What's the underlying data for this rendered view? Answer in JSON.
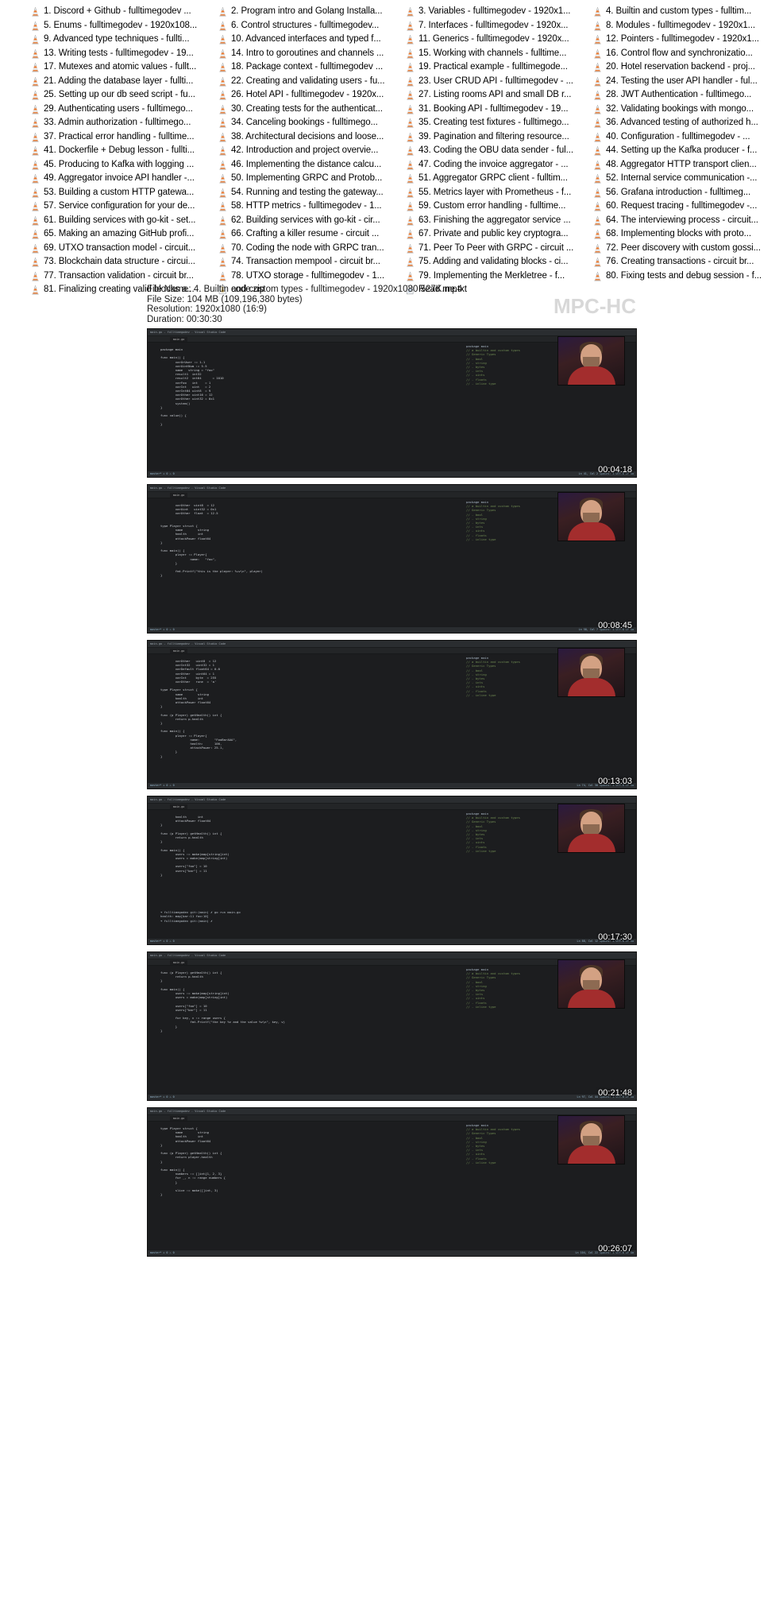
{
  "window": {
    "app_name": "MPC-HC"
  },
  "filelist": {
    "icon_name": "vlc-cone-icon",
    "zip_icon_name": "zip-archive-icon",
    "text_icon_name": "text-file-icon",
    "items": [
      {
        "label": "1. Discord + Github - fulltimegodev ...",
        "icon": "vlc-cone-icon"
      },
      {
        "label": "2. Program intro and Golang Installa...",
        "icon": "vlc-cone-icon"
      },
      {
        "label": "3. Variables - fulltimegodev - 1920x1...",
        "icon": "vlc-cone-icon"
      },
      {
        "label": "4. Builtin and custom types - fulltim...",
        "icon": "vlc-cone-icon"
      },
      {
        "label": "5. Enums - fulltimegodev - 1920x108...",
        "icon": "vlc-cone-icon"
      },
      {
        "label": "6. Control structures - fulltimegodev...",
        "icon": "vlc-cone-icon"
      },
      {
        "label": "7. Interfaces - fulltimegodev - 1920x...",
        "icon": "vlc-cone-icon"
      },
      {
        "label": "8. Modules - fulltimegodev - 1920x1...",
        "icon": "vlc-cone-icon"
      },
      {
        "label": "9. Advanced type techniques - fullti...",
        "icon": "vlc-cone-icon"
      },
      {
        "label": "10. Advanced interfaces and typed f...",
        "icon": "vlc-cone-icon"
      },
      {
        "label": "11. Generics - fulltimegodev - 1920x...",
        "icon": "vlc-cone-icon"
      },
      {
        "label": "12. Pointers - fulltimegodev - 1920x1...",
        "icon": "vlc-cone-icon"
      },
      {
        "label": "13. Writing tests - fulltimegodev - 19...",
        "icon": "vlc-cone-icon"
      },
      {
        "label": "14. Intro to goroutines and channels ...",
        "icon": "vlc-cone-icon"
      },
      {
        "label": "15. Working with channels - fulltime...",
        "icon": "vlc-cone-icon"
      },
      {
        "label": "16. Control flow and synchronizatio...",
        "icon": "vlc-cone-icon"
      },
      {
        "label": "17. Mutexes and atomic values - fullt...",
        "icon": "vlc-cone-icon"
      },
      {
        "label": "18. Package context - fulltimegodev ...",
        "icon": "vlc-cone-icon"
      },
      {
        "label": "19. Practical example - fulltimegode...",
        "icon": "vlc-cone-icon"
      },
      {
        "label": "20. Hotel reservation backend - proj...",
        "icon": "vlc-cone-icon"
      },
      {
        "label": "21. Adding the database layer - fullti...",
        "icon": "vlc-cone-icon"
      },
      {
        "label": "22. Creating and validating users - fu...",
        "icon": "vlc-cone-icon"
      },
      {
        "label": "23. User CRUD API - fulltimegodev - ...",
        "icon": "vlc-cone-icon"
      },
      {
        "label": "24. Testing the user API handler - ful...",
        "icon": "vlc-cone-icon"
      },
      {
        "label": "25. Setting up our db seed script - fu...",
        "icon": "vlc-cone-icon"
      },
      {
        "label": "26. Hotel API - fulltimegodev - 1920x...",
        "icon": "vlc-cone-icon"
      },
      {
        "label": "27. Listing rooms API and small DB r...",
        "icon": "vlc-cone-icon"
      },
      {
        "label": "28. JWT Authentication - fulltimego...",
        "icon": "vlc-cone-icon"
      },
      {
        "label": "29. Authenticating users - fulltimego...",
        "icon": "vlc-cone-icon"
      },
      {
        "label": "30. Creating tests for the authenticat...",
        "icon": "vlc-cone-icon"
      },
      {
        "label": "31. Booking API - fulltimegodev - 19...",
        "icon": "vlc-cone-icon"
      },
      {
        "label": "32. Validating bookings with mongo...",
        "icon": "vlc-cone-icon"
      },
      {
        "label": "33. Admin authorization - fulltimego...",
        "icon": "vlc-cone-icon"
      },
      {
        "label": "34. Canceling bookings - fulltimego...",
        "icon": "vlc-cone-icon"
      },
      {
        "label": "35. Creating test fixtures - fulltimego...",
        "icon": "vlc-cone-icon"
      },
      {
        "label": "36. Advanced testing of authorized h...",
        "icon": "vlc-cone-icon"
      },
      {
        "label": "37. Practical error handling - fulltime...",
        "icon": "vlc-cone-icon"
      },
      {
        "label": "38. Architectural decisions and loose...",
        "icon": "vlc-cone-icon"
      },
      {
        "label": "39. Pagination and filtering resource...",
        "icon": "vlc-cone-icon"
      },
      {
        "label": "40. Configuration - fulltimegodev - ...",
        "icon": "vlc-cone-icon"
      },
      {
        "label": "41. Dockerfile + Debug lesson - fullti...",
        "icon": "vlc-cone-icon"
      },
      {
        "label": "42. Introduction and project overvie...",
        "icon": "vlc-cone-icon"
      },
      {
        "label": "43. Coding the OBU data sender - ful...",
        "icon": "vlc-cone-icon"
      },
      {
        "label": "44. Setting up the Kafka producer - f...",
        "icon": "vlc-cone-icon"
      },
      {
        "label": "45. Producing to Kafka with logging ...",
        "icon": "vlc-cone-icon"
      },
      {
        "label": "46. Implementing the distance calcu...",
        "icon": "vlc-cone-icon"
      },
      {
        "label": "47. Coding the invoice aggregator - ...",
        "icon": "vlc-cone-icon"
      },
      {
        "label": "48. Aggregator HTTP transport clien...",
        "icon": "vlc-cone-icon"
      },
      {
        "label": "49. Aggregator invoice API handler -...",
        "icon": "vlc-cone-icon"
      },
      {
        "label": "50. Implementing GRPC and Protob...",
        "icon": "vlc-cone-icon"
      },
      {
        "label": "51. Aggregator GRPC client - fulltim...",
        "icon": "vlc-cone-icon"
      },
      {
        "label": "52. Internal service communication -...",
        "icon": "vlc-cone-icon"
      },
      {
        "label": "53. Building a custom HTTP gatewa...",
        "icon": "vlc-cone-icon"
      },
      {
        "label": "54. Running and testing the gateway...",
        "icon": "vlc-cone-icon"
      },
      {
        "label": "55. Metrics layer with Prometheus - f...",
        "icon": "vlc-cone-icon"
      },
      {
        "label": "56. Grafana introduction - fulltimeg...",
        "icon": "vlc-cone-icon"
      },
      {
        "label": "57. Service configuration for your de...",
        "icon": "vlc-cone-icon"
      },
      {
        "label": "58. HTTP metrics - fulltimegodev - 1...",
        "icon": "vlc-cone-icon"
      },
      {
        "label": "59. Custom error handling - fulltime...",
        "icon": "vlc-cone-icon"
      },
      {
        "label": "60. Request tracing - fulltimegodev -...",
        "icon": "vlc-cone-icon"
      },
      {
        "label": "61. Building services with go-kit - set...",
        "icon": "vlc-cone-icon"
      },
      {
        "label": "62. Building services with go-kit - cir...",
        "icon": "vlc-cone-icon"
      },
      {
        "label": "63. Finishing the aggregator service ...",
        "icon": "vlc-cone-icon"
      },
      {
        "label": "64. The interviewing process - circuit...",
        "icon": "vlc-cone-icon"
      },
      {
        "label": "65. Making an amazing GitHub profi...",
        "icon": "vlc-cone-icon"
      },
      {
        "label": "66. Crafting a killer resume - circuit ...",
        "icon": "vlc-cone-icon"
      },
      {
        "label": "67. Private and public key cryptogra...",
        "icon": "vlc-cone-icon"
      },
      {
        "label": "68. Implementing blocks with proto...",
        "icon": "vlc-cone-icon"
      },
      {
        "label": "69. UTXO transaction model - circuit...",
        "icon": "vlc-cone-icon"
      },
      {
        "label": "70. Coding the node with GRPC tran...",
        "icon": "vlc-cone-icon"
      },
      {
        "label": "71. Peer To Peer with GRPC - circuit ...",
        "icon": "vlc-cone-icon"
      },
      {
        "label": "72. Peer discovery with custom gossi...",
        "icon": "vlc-cone-icon"
      },
      {
        "label": "73. Blockchain data structure - circui...",
        "icon": "vlc-cone-icon"
      },
      {
        "label": "74. Transaction mempool - circuit br...",
        "icon": "vlc-cone-icon"
      },
      {
        "label": "75. Adding and validating blocks - ci...",
        "icon": "vlc-cone-icon"
      },
      {
        "label": "76. Creating transactions - circuit br...",
        "icon": "vlc-cone-icon"
      },
      {
        "label": "77. Transaction validation - circuit br...",
        "icon": "vlc-cone-icon"
      },
      {
        "label": "78. UTXO storage - fulltimegodev - 1...",
        "icon": "vlc-cone-icon"
      },
      {
        "label": "79. Implementing the Merkletree - f...",
        "icon": "vlc-cone-icon"
      },
      {
        "label": "80. Fixing tests and debug session - f...",
        "icon": "vlc-cone-icon"
      },
      {
        "label": "81. Finalizing creating valid blocks a...",
        "icon": "vlc-cone-icon"
      },
      {
        "label": "code.zip",
        "icon": "zip-archive-icon"
      },
      {
        "label": "Read me.txt",
        "icon": "text-file-icon"
      }
    ]
  },
  "info": {
    "file_name_label": "File Name:",
    "file_name_value": "4. Builtin and custom types  -  fulltimegodev  -  1920x1080 527K.mp4",
    "file_size_label": "File Size:",
    "file_size_value": "104 MB (109,196,380 bytes)",
    "resolution_label": "Resolution:",
    "resolution_value": "1920x1080 (16:9)",
    "duration_label": "Duration:",
    "duration_value": "00:30:30",
    "watermark": "MPC-HC"
  },
  "thumbnails": [
    {
      "timestamp": "00:04:18",
      "titlebar": "main.go - fulltimegodev - Visual Studio Code",
      "tab": "main.go",
      "status_left": "master*  ✕ 0  ⚠ 0",
      "status_right": "Ln 41, Col 2   Spaces: 4   UTF-8   LF   Go",
      "code": "package main\n\nfunc main() {\n\tvarOrUser := 1.1\n\tvarUintNum := 5.5\n\tname   string = \"foo\"\n\tresult1  int32\n\tresult2  int64      = 1010\n\tvarFoo   int    = 1\n\tvarInt   uint   = 2\n\tvarInt64 uint8  = 9\n\tvarOther uint16 = 12\n\tvarOther uint32 = 0x1\n\tsystem()\n}\n\nfunc value() {\n\n}",
      "rightpane_header": "package main",
      "rightpane_lines": "// a builtin and custom types\n// Generic Types\n// - bool\n// - string\n// - bytes\n// - ints\n// - uints\n// - floats\n// - inline type"
    },
    {
      "timestamp": "00:08:45",
      "titlebar": "main.go - fulltimegodev - Visual Studio Code",
      "tab": "main.go",
      "status_left": "master*  ✕ 0  ⚠ 0",
      "status_right": "Ln 58, Col 7   Spaces: 4   UTF-8   LF   Go",
      "code": "\tvarOther  uint8  = 12\n\tvarUint   uint32 = 0x1\n\tvarOther  float  = 12.5\n\n\ntype Player struct {\n\tname        string\n\thealth      int\n\tattackPower float64\n}\n\nfunc main() {\n\tplayer := Player{\n\t\tname:   \"foo\",\n\t}\n\n\tfmt.Printf(\"this is the player: %+v\\n\", player)\n}",
      "rightpane_header": "package main",
      "rightpane_lines": "// a builtin and custom types\n// Generic Types\n// - bool\n// - string\n// - bytes\n// - ints\n// - uints\n// - floats\n// - inline type"
    },
    {
      "timestamp": "00:13:03",
      "titlebar": "main.go - fulltimegodev - Visual Studio Code",
      "tab": "main.go",
      "status_left": "master*  ✕ 0  ⚠ 0",
      "status_right": "Ln 74, Col 30   Spaces: 4   UTF-8   LF   Go",
      "code": "\tvarOther   uint8  = 12\n\tvarInt32   uint32 = 1\n\tvarDefault float64 = 0.0\n\tvarOther   uint64 = 1\n\tvarInt     byte  = 255\n\tvarOther   rune  = 'a'\n\ntype Player struct {\n\tname        string\n\thealth      int\n\tattackPower float64\n}\n\nfunc (p Player) getHealth() int {\n\treturn p.health\n}\n\nfunc main() {\n\tplayer := Player{\n\t\tname:        \"FooBarAAA\",\n\t\thealth:      100,\n\t\tattackPower: 25.1,\n\t}\n}",
      "rightpane_header": "package main",
      "rightpane_lines": "// a builtin and custom types\n// Generic Types\n// - bool\n// - string\n// - bytes\n// - ints\n// - uints\n// - floats\n// - inline type"
    },
    {
      "timestamp": "00:17:30",
      "titlebar": "main.go - fulltimegodev - Visual Studio Code",
      "tab": "main.go",
      "status_left": "master*  ✕ 0  ⚠ 0",
      "status_right": "Ln 88, Col 12   Spaces: 4   UTF-8   LF   Go",
      "code": "\thealth      int\n\tattackPower float64\n}\n\nfunc (p Player) getHealth() int {\n\treturn p.health\n}\n\nfunc main() {\n\tusers := make(map[string]int)\n\tusers = make(map[string]int)\n\n\tusers[\"foo\"] = 10\n\tusers[\"bar\"] = 11\n}",
      "rightpane_header": "package main",
      "rightpane_lines": "// a builtin and custom types\n// Generic Types\n// - bool\n// - string\n// - bytes\n// - ints\n// - uints\n// - floats\n// - inline type",
      "terminal": "➜ fulltimegodev git:(main) ✗ go run main.go\nhealth: map[bar:11 foo:10]\n➜ fulltimegodev git:(main) ✗"
    },
    {
      "timestamp": "00:21:48",
      "titlebar": "main.go - fulltimegodev - Visual Studio Code",
      "tab": "main.go",
      "status_left": "master*  ✕ 0  ⚠ 0",
      "status_right": "Ln 97, Col 44   Spaces: 4   UTF-8   LF   Go",
      "code": "func (p Player) getHealth() int {\n\treturn p.health\n}\n\nfunc main() {\n\tusers := make(map[string]int)\n\tusers = make(map[string]int)\n\n\tusers[\"foo\"] = 10\n\tusers[\"bar\"] = 11\n\n\tfor key, v := range users {\n\t\tfmt.Printf(\"the key %v and the value %v\\n\", key, v)\n\t}\n}",
      "rightpane_header": "package main",
      "rightpane_lines": "// a builtin and custom types\n// Generic Types\n// - bool\n// - string\n// - bytes\n// - ints\n// - uints\n// - floats\n// - inline type"
    },
    {
      "timestamp": "00:26:07",
      "titlebar": "main.go - fulltimegodev - Visual Studio Code",
      "tab": "main.go",
      "status_left": "master*  ✕ 0  ⚠ 0",
      "status_right": "Ln 104, Col 22   Spaces: 4   UTF-8   LF   Go",
      "code": "type Player struct {\n\tname        string\n\thealth      int\n\tattackPower float64\n}\n\nfunc (p Player) getHealth() int {\n\treturn player.health\n}\n\nfunc main() {\n\tnumbers := []int{1, 2, 3}\n\tfor _, n := range numbers {\n\t}\n\n\tslice := make([]int, 3)\n}",
      "rightpane_header": "package main",
      "rightpane_lines": "// a builtin and custom types\n// Generic Types\n// - bool\n// - string\n// - bytes\n// - ints\n// - uints\n// - floats\n// - inline type"
    }
  ]
}
